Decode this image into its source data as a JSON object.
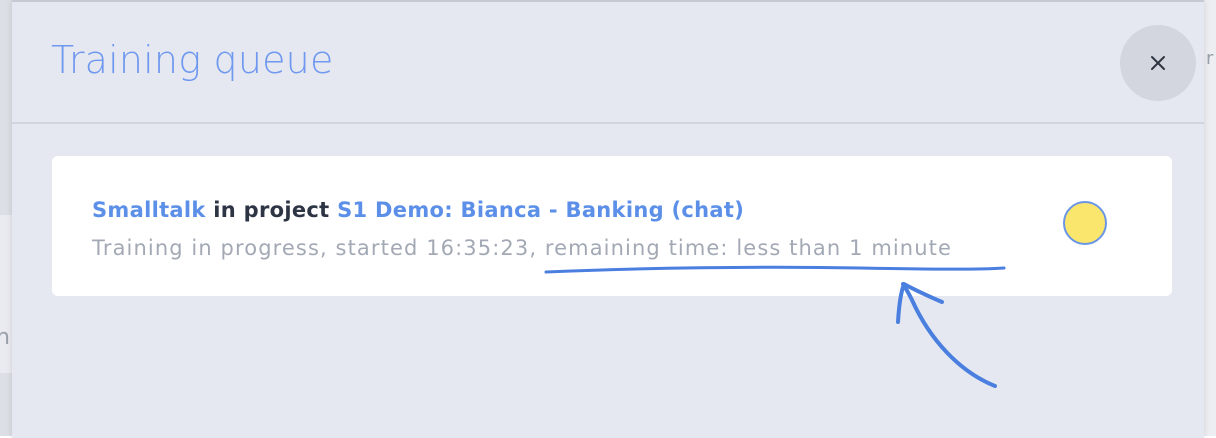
{
  "background": {
    "left_glyph": "n",
    "right_glyph": "r"
  },
  "modal": {
    "title": "Training queue",
    "close_label": "×"
  },
  "queue": {
    "items": [
      {
        "model_name": "Smalltalk",
        "project_connector": "in project",
        "project_name": "S1 Demo: Bianca - Banking (chat)",
        "status_text": "Training in progress, started 16:35:23, remaining time: less than 1 minute",
        "status_indicator": "in-progress",
        "status_color": "#fbe66d"
      }
    ]
  },
  "colors": {
    "accent": "#5b8fe8",
    "title": "#6f98f0",
    "muted_text": "#a3a9b4",
    "annotation": "#4a7fe0"
  },
  "icons": {
    "close": "close-icon"
  }
}
